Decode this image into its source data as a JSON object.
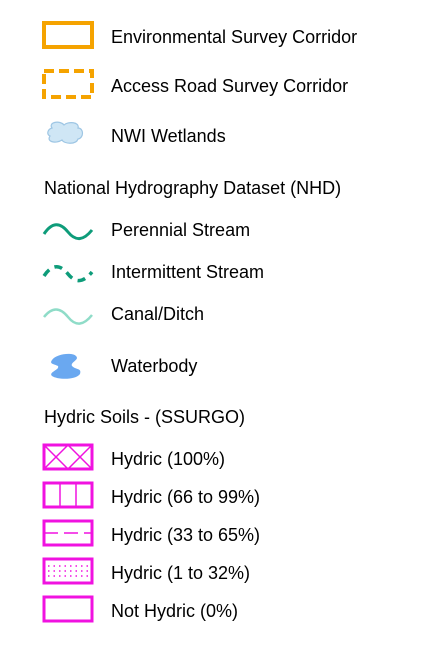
{
  "legend": {
    "items": [
      {
        "label": "Environmental Survey Corridor",
        "icon": "solid-orange-rectangle-icon",
        "color": "#F5A300"
      },
      {
        "label": "Access Road Survey Corridor",
        "icon": "dashed-orange-rectangle-icon",
        "color": "#F5A300"
      },
      {
        "label": "NWI Wetlands",
        "icon": "wetland-polygon-icon",
        "color": "#CFE6F5"
      }
    ],
    "nhd": {
      "heading": "National Hydrography Dataset (NHD)",
      "items": [
        {
          "label": "Perennial Stream",
          "icon": "solid-stream-icon",
          "color": "#0E9C7A"
        },
        {
          "label": "Intermittent Stream",
          "icon": "dashed-stream-icon",
          "color": "#0E9C7A"
        },
        {
          "label": "Canal/Ditch",
          "icon": "canal-icon",
          "color": "#8FDCC8"
        },
        {
          "label": "Waterbody",
          "icon": "waterbody-icon",
          "color": "#6AA8F0"
        }
      ]
    },
    "soils": {
      "heading": "Hydric Soils - (SSURGO)",
      "color": "#F012E0",
      "items": [
        {
          "label": "Hydric (100%)",
          "icon": "cross-hatch-box-icon"
        },
        {
          "label": "Hydric (66 to 99%)",
          "icon": "vertical-lines-box-icon"
        },
        {
          "label": "Hydric (33 to 65%)",
          "icon": "dashed-horizontal-box-icon"
        },
        {
          "label": "Hydric (1 to 32%)",
          "icon": "dotted-box-icon"
        },
        {
          "label": "Not Hydric (0%)",
          "icon": "empty-box-icon"
        }
      ]
    }
  }
}
